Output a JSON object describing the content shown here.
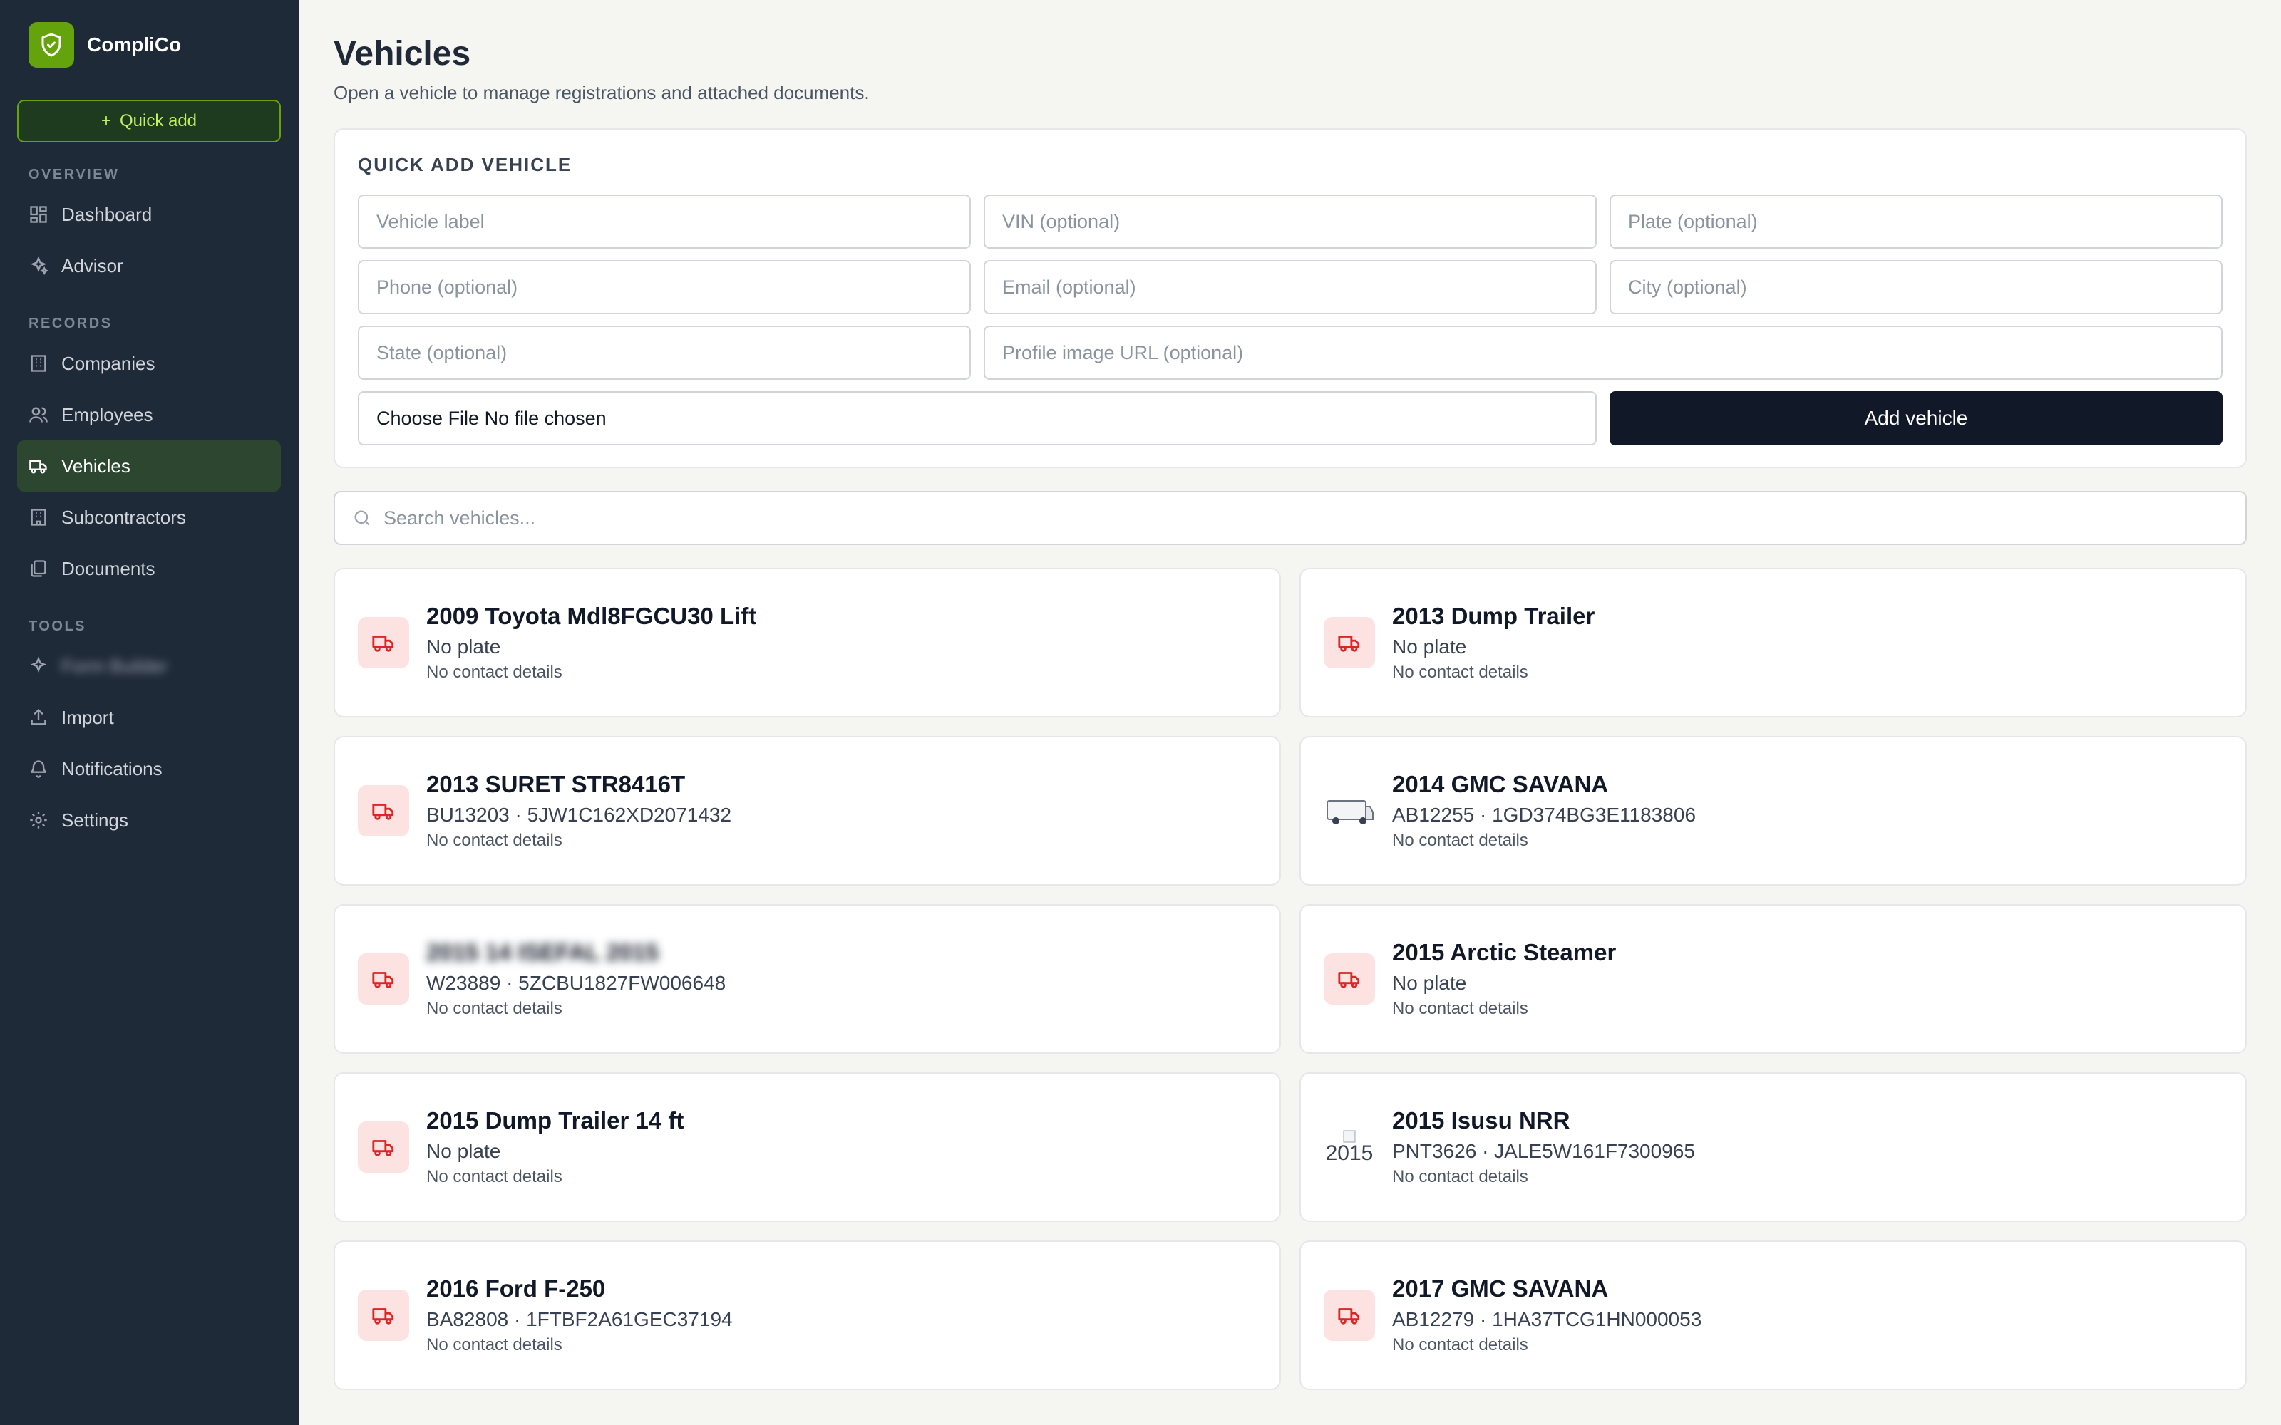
{
  "app": {
    "name": "CompliCo"
  },
  "sidebar": {
    "quick_add": "Quick add",
    "sections": {
      "overview": "OVERVIEW",
      "records": "RECORDS",
      "tools": "TOOLS"
    },
    "items": {
      "dashboard": "Dashboard",
      "advisor": "Advisor",
      "companies": "Companies",
      "employees": "Employees",
      "vehicles": "Vehicles",
      "subcontractors": "Subcontractors",
      "documents": "Documents",
      "tools_hidden": "Form Builder",
      "import": "Import",
      "notifications": "Notifications",
      "settings": "Settings"
    },
    "accent": "#65a30d"
  },
  "page": {
    "title": "Vehicles",
    "subtitle": "Open a vehicle to manage registrations and attached documents."
  },
  "quick_add_panel": {
    "title": "QUICK ADD VEHICLE",
    "placeholders": {
      "label": "Vehicle label",
      "vin": "VIN (optional)",
      "plate": "Plate (optional)",
      "phone": "Phone (optional)",
      "email": "Email (optional)",
      "city": "City (optional)",
      "state": "State (optional)",
      "image_url": "Profile image URL (optional)"
    },
    "file_input": "Choose File No file chosen",
    "submit": "Add vehicle"
  },
  "search": {
    "placeholder": "Search vehicles..."
  },
  "vehicles": [
    {
      "name": "2009 Toyota Mdl8FGCU30 Lift",
      "plate": "No plate",
      "contact": "No contact details",
      "icon": "truck-icon"
    },
    {
      "name": "2013 Dump Trailer",
      "plate": "No plate",
      "contact": "No contact details",
      "icon": "truck-icon"
    },
    {
      "name": "2013 SURET STR8416T",
      "plate": "BU13203 · 5JW1C162XD2071432",
      "contact": "No contact details",
      "icon": "truck-icon"
    },
    {
      "name": "2014 GMC SAVANA",
      "plate": "AB12255 · 1GD374BG3E1183806",
      "contact": "No contact details",
      "icon": "van-photo"
    },
    {
      "name": "2015 14 ISEFAL 2015",
      "plate": "W23889 · 5ZCBU1827FW006648",
      "contact": "No contact details",
      "icon": "truck-icon"
    },
    {
      "name": "2015 Arctic Steamer",
      "plate": "No plate",
      "contact": "No contact details",
      "icon": "truck-icon"
    },
    {
      "name": "2015 Dump Trailer 14 ft",
      "plate": "No plate",
      "contact": "No contact details",
      "icon": "truck-icon"
    },
    {
      "name": "2015 Isusu NRR",
      "plate": "PNT3626 · JALE5W161F7300965",
      "contact": "No contact details",
      "icon": "broken-image",
      "alt": "2015"
    },
    {
      "name": "2016 Ford F-250",
      "plate": "BA82808 · 1FTBF2A61GEC37194",
      "contact": "No contact details",
      "icon": "truck-icon"
    },
    {
      "name": "2017 GMC SAVANA",
      "plate": "AB12279 · 1HA37TCG1HN000053",
      "contact": "No contact details",
      "icon": "truck-icon"
    }
  ]
}
